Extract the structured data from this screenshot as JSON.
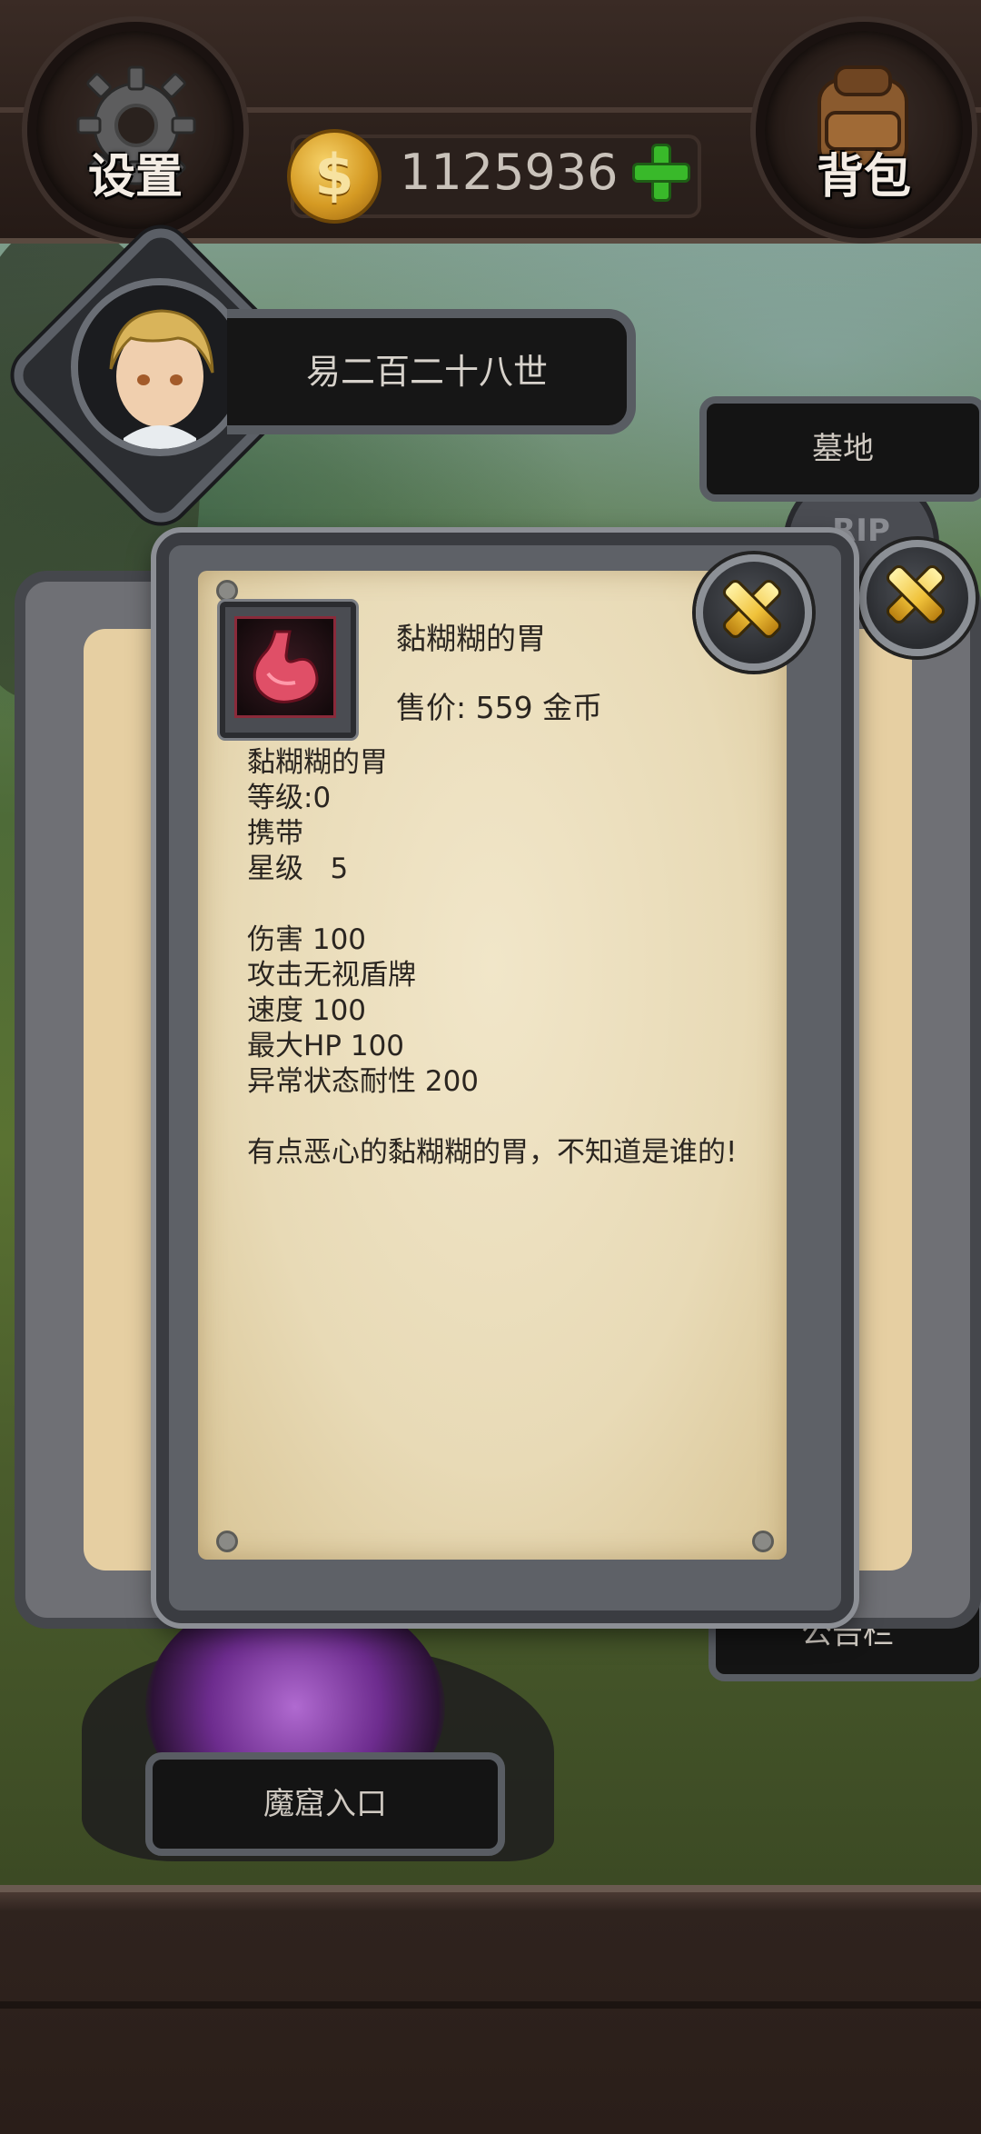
{
  "topbar": {
    "settings_label": "设置",
    "bag_label": "背包",
    "coins": "1125936",
    "coin_symbol": "$"
  },
  "player": {
    "name": "易二百二十八世"
  },
  "locations": {
    "graveyard": "墓地",
    "bulletin": "公告栏",
    "dungeon": "魔窟入口",
    "tomb_text": "RIP"
  },
  "item": {
    "name": "黏糊糊的胃",
    "price_line": "售价: 559 金币",
    "details": {
      "name": "黏糊糊的胃",
      "level": "等级:0",
      "carry": "携带",
      "stars": "星级   5",
      "damage": "伤害 100",
      "ignore_shield": "攻击无视盾牌",
      "speed": "速度 100",
      "max_hp": "最大HP 100",
      "resist": "异常状态耐性 200"
    },
    "description": "有点恶心的黏糊糊的胃，不知道是谁的!"
  }
}
